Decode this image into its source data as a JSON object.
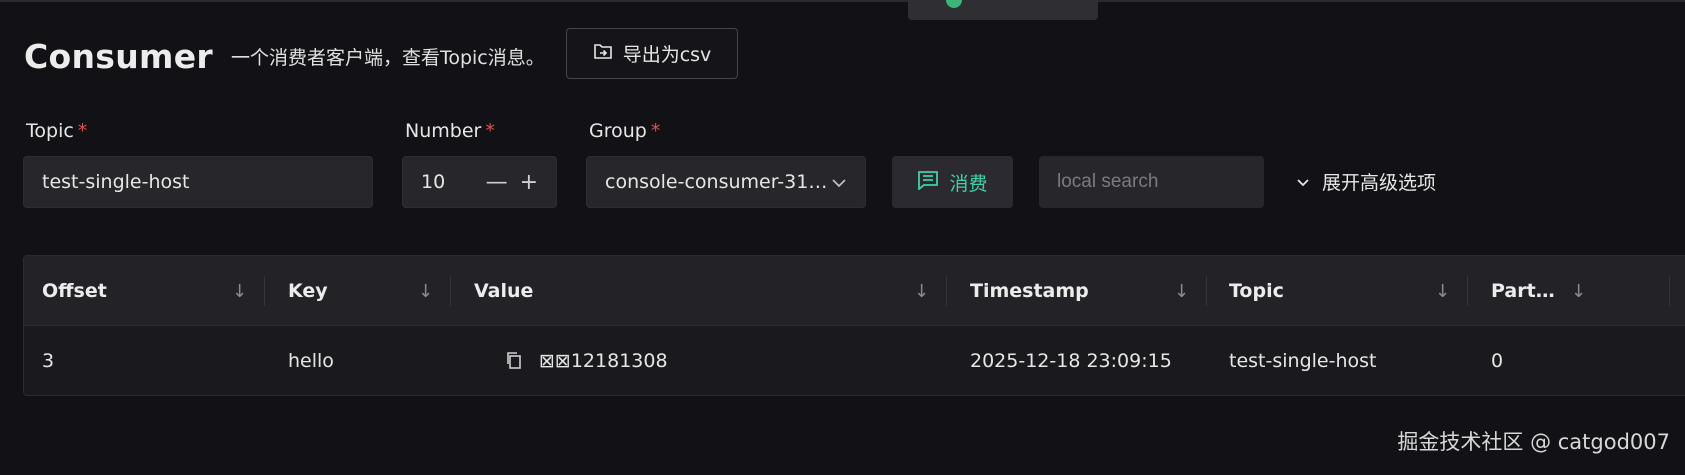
{
  "page": {
    "title": "Consumer",
    "subtitle": "一个消费者客户端，查看Topic消息。",
    "export_label": "导出为csv"
  },
  "form": {
    "topic": {
      "label": "Topic",
      "required": "*",
      "value": "test-single-host"
    },
    "number": {
      "label": "Number",
      "required": "*",
      "value": "10",
      "minus": "—",
      "plus": "+"
    },
    "group": {
      "label": "Group",
      "required": "*",
      "value": "console-consumer-31…"
    },
    "consume_label": "消费",
    "search_placeholder": "local search",
    "advanced_label": "展开高级选项"
  },
  "table": {
    "columns": [
      "Offset",
      "Key",
      "Value",
      "Timestamp",
      "Topic",
      "Part…"
    ],
    "sort_icon": "↓",
    "rows": [
      {
        "offset": "3",
        "key": "hello",
        "value": "⊠⊠12181308",
        "timestamp": "2025-12-18 23:09:15",
        "topic": "test-single-host",
        "partition": "0"
      }
    ]
  },
  "watermark": "掘金技术社区 @ catgod007",
  "colors": {
    "accent": "#3fd1a6",
    "required": "#e05252",
    "background": "#111116"
  },
  "icons": {
    "export": "export-icon",
    "consume": "message-icon",
    "copy": "copy-icon",
    "chevron": "chevron-down-icon"
  }
}
